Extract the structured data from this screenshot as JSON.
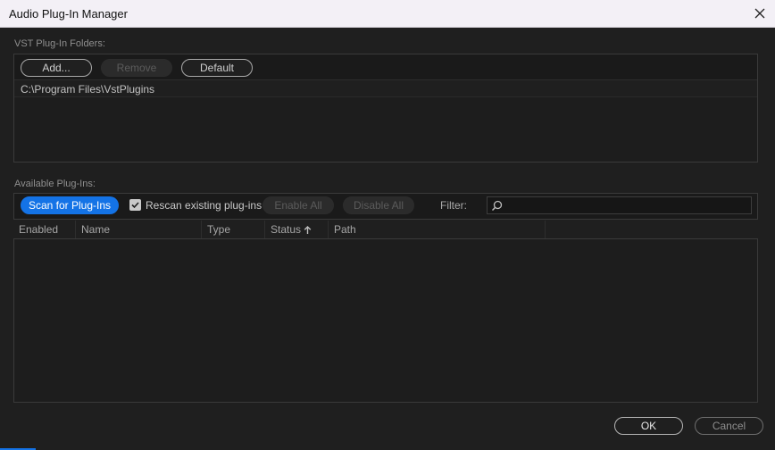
{
  "window": {
    "title": "Audio Plug-In Manager"
  },
  "vst_folders": {
    "label": "VST Plug-In Folders:",
    "buttons": {
      "add": "Add...",
      "remove": "Remove",
      "default": "Default"
    },
    "paths": [
      "C:\\Program Files\\VstPlugins"
    ]
  },
  "available": {
    "label": "Available Plug-Ins:",
    "scan_label": "Scan for Plug-Ins",
    "rescan_label": "Rescan existing plug-ins",
    "rescan_checked": true,
    "enable_all_label": "Enable All",
    "disable_all_label": "Disable All",
    "filter_label": "Filter:",
    "filter_value": ""
  },
  "columns": [
    "Enabled",
    "Name",
    "Type",
    "Status",
    "Path"
  ],
  "sort": {
    "column": "Status",
    "direction": "ascending"
  },
  "rows": [],
  "footer": {
    "ok_label": "OK",
    "cancel_label": "Cancel"
  },
  "colors": {
    "accent": "#1473e6",
    "background": "#1f1f1f",
    "titlebar": "#f3f0f6"
  }
}
